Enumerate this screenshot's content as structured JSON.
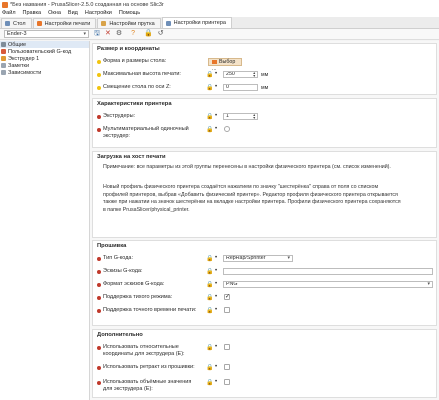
{
  "window": {
    "title": "*Без названия - PrusaSlicer-2.5.0 созданная на основе Slic3r"
  },
  "menu": [
    "Файл",
    "Правка",
    "Окна",
    "Вид",
    "Настройки",
    "Помощь"
  ],
  "tabs": [
    {
      "label": "Стол",
      "color": "#6f8fb8"
    },
    {
      "label": "Настройки печати",
      "color": "#e8762a"
    },
    {
      "label": "Настройки прутка",
      "color": "#d8a34a"
    },
    {
      "label": "Настройки принтера",
      "color": "#6f8fb8"
    }
  ],
  "toolbar": {
    "preset": "Ender-3",
    "icons": [
      "save-icon",
      "delete-icon",
      "compare-icon",
      "help-icon",
      "reset-icon",
      "undo-icon"
    ]
  },
  "sidebar": {
    "items": [
      {
        "label": "Общие",
        "color": "#7f8c99"
      },
      {
        "label": "Пользовательский G-код",
        "color": "#d85a3a"
      },
      {
        "label": "Экструдер 1",
        "color": "#e09a33"
      },
      {
        "label": "Заметки",
        "color": "#9aa5b1"
      },
      {
        "label": "Зависимости",
        "color": "#9aa5b1"
      }
    ]
  },
  "sections": {
    "size": {
      "title": "Размер и координаты",
      "bed_shape": {
        "label": "Форма и размеры стола:",
        "button": "Выбор ..."
      },
      "max_height": {
        "label": "Максимальная высота печати:",
        "value": "250",
        "unit": "мм"
      },
      "z_offset": {
        "label": "Смещение стола по оси Z:",
        "value": "0",
        "unit": "мм"
      }
    },
    "features": {
      "title": "Характеристики принтера",
      "extruders": {
        "label": "Экструдеры:",
        "value": "1"
      },
      "multi_material": {
        "label": "Мультиматериальный одиночный экструдер:"
      }
    },
    "host": {
      "title": "Загрузка на хост печати",
      "note1": "Примечание: все параметры из этой группы перенесены в настройки физического принтера (см. список изменений).",
      "note2": "Новый профиль физического принтера создаётся нажатием по значку \"шестерёнка\" справа от поля со списком профилей принтеров, выбрав «Добавить физический принтер». Редактор профиля физического принтера открывается также при нажатии на значок шестерёнки на вкладке настройки принтера. Профили физического принтера сохраняются в папке PrusaSlicer/physical_printer."
    },
    "firmware": {
      "title": "Прошивка",
      "gcode_flavor": {
        "label": "Тип G-кода:",
        "value": "RepRap/Sprinter"
      },
      "thumbnails": {
        "label": "Эскизы G-кода:",
        "value": ""
      },
      "thumbnails_format": {
        "label": "Формат эскизов G-кода:",
        "value": "PNG"
      },
      "remaining_times": {
        "label": "Поддержка тихого режима:"
      },
      "binary_gcode": {
        "label": "Поддержка точного времени печати:"
      }
    },
    "advanced": {
      "title": "Дополнительно",
      "relative_e": {
        "label": "Использовать относительные координаты для экструдера (E):"
      },
      "fw_retraction": {
        "label": "Использовать ретракт из прошивки:"
      },
      "volumetric_e": {
        "label": "Использовать объёмные значения для экструдера (E):"
      }
    }
  },
  "colors": {
    "accent": "#e8762a",
    "bullet_red": "#c0392b",
    "bullet_yellow": "#f1c40f"
  }
}
